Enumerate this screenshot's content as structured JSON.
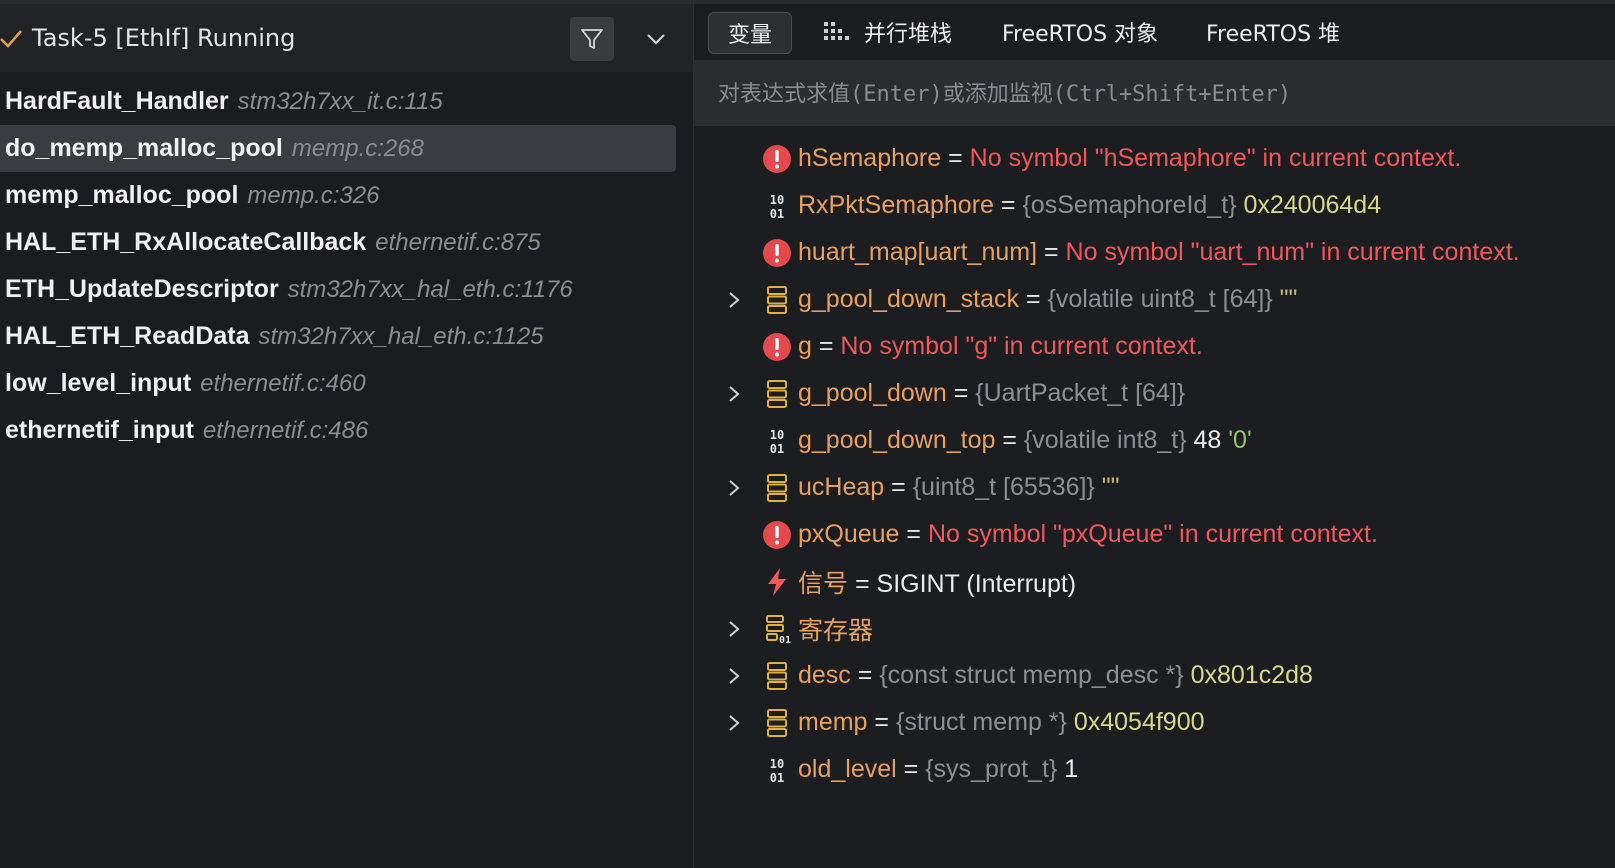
{
  "callstack": {
    "title": "Task-5 [EthIf] Running",
    "frames": [
      {
        "function": "HardFault_Handler",
        "source": "stm32h7xx_it.c:115"
      },
      {
        "function": "do_memp_malloc_pool",
        "source": "memp.c:268"
      },
      {
        "function": "memp_malloc_pool",
        "source": "memp.c:326"
      },
      {
        "function": "HAL_ETH_RxAllocateCallback",
        "source": "ethernetif.c:875"
      },
      {
        "function": "ETH_UpdateDescriptor",
        "source": "stm32h7xx_hal_eth.c:1176"
      },
      {
        "function": "HAL_ETH_ReadData",
        "source": "stm32h7xx_hal_eth.c:1125"
      },
      {
        "function": "low_level_input",
        "source": "ethernetif.c:460"
      },
      {
        "function": "ethernetif_input",
        "source": "ethernetif.c:486"
      }
    ]
  },
  "tabs": {
    "variables": "变量",
    "parallel_stacks": "并行堆栈",
    "freertos_objects": "FreeRTOS 对象",
    "freertos_heap": "FreeRTOS 堆"
  },
  "eval": {
    "placeholder": "对表达式求值(Enter)或添加监视(Ctrl+Shift+Enter)"
  },
  "variables": [
    {
      "name": "hSemaphore",
      "eq": "=",
      "error": "No symbol \"hSemaphore\" in current context."
    },
    {
      "name": "RxPktSemaphore",
      "eq": "=",
      "type": "{osSemaphoreId_t}",
      "value": "0x240064d4"
    },
    {
      "name": "huart_map[uart_num]",
      "eq": "=",
      "error": "No symbol \"uart_num\" in current context."
    },
    {
      "name": "g_pool_down_stack",
      "eq": "=",
      "type": "{volatile uint8_t [64]}",
      "value": "\"\""
    },
    {
      "name": "g",
      "eq": "=",
      "error": "No symbol \"g\" in current context."
    },
    {
      "name": "g_pool_down",
      "eq": "=",
      "type": "{UartPacket_t [64]}"
    },
    {
      "name": "g_pool_down_top",
      "eq": "=",
      "type": "{volatile int8_t}",
      "value": "48",
      "extra": "'0'"
    },
    {
      "name": "ucHeap",
      "eq": "=",
      "type": "{uint8_t [65536]}",
      "value": "\"\""
    },
    {
      "name": "pxQueue",
      "eq": "=",
      "error": "No symbol \"pxQueue\" in current context."
    },
    {
      "name": "信号",
      "eq": "=",
      "value": "SIGINT (Interrupt)"
    },
    {
      "name": "寄存器"
    },
    {
      "name": "desc",
      "eq": "=",
      "type": "{const struct memp_desc *}",
      "value": "0x801c2d8"
    },
    {
      "name": "memp",
      "eq": "=",
      "type": "{struct memp *}",
      "value": "0x4054f900"
    },
    {
      "name": "old_level",
      "eq": "=",
      "type": "{sys_prot_t}",
      "value": "1"
    }
  ]
}
